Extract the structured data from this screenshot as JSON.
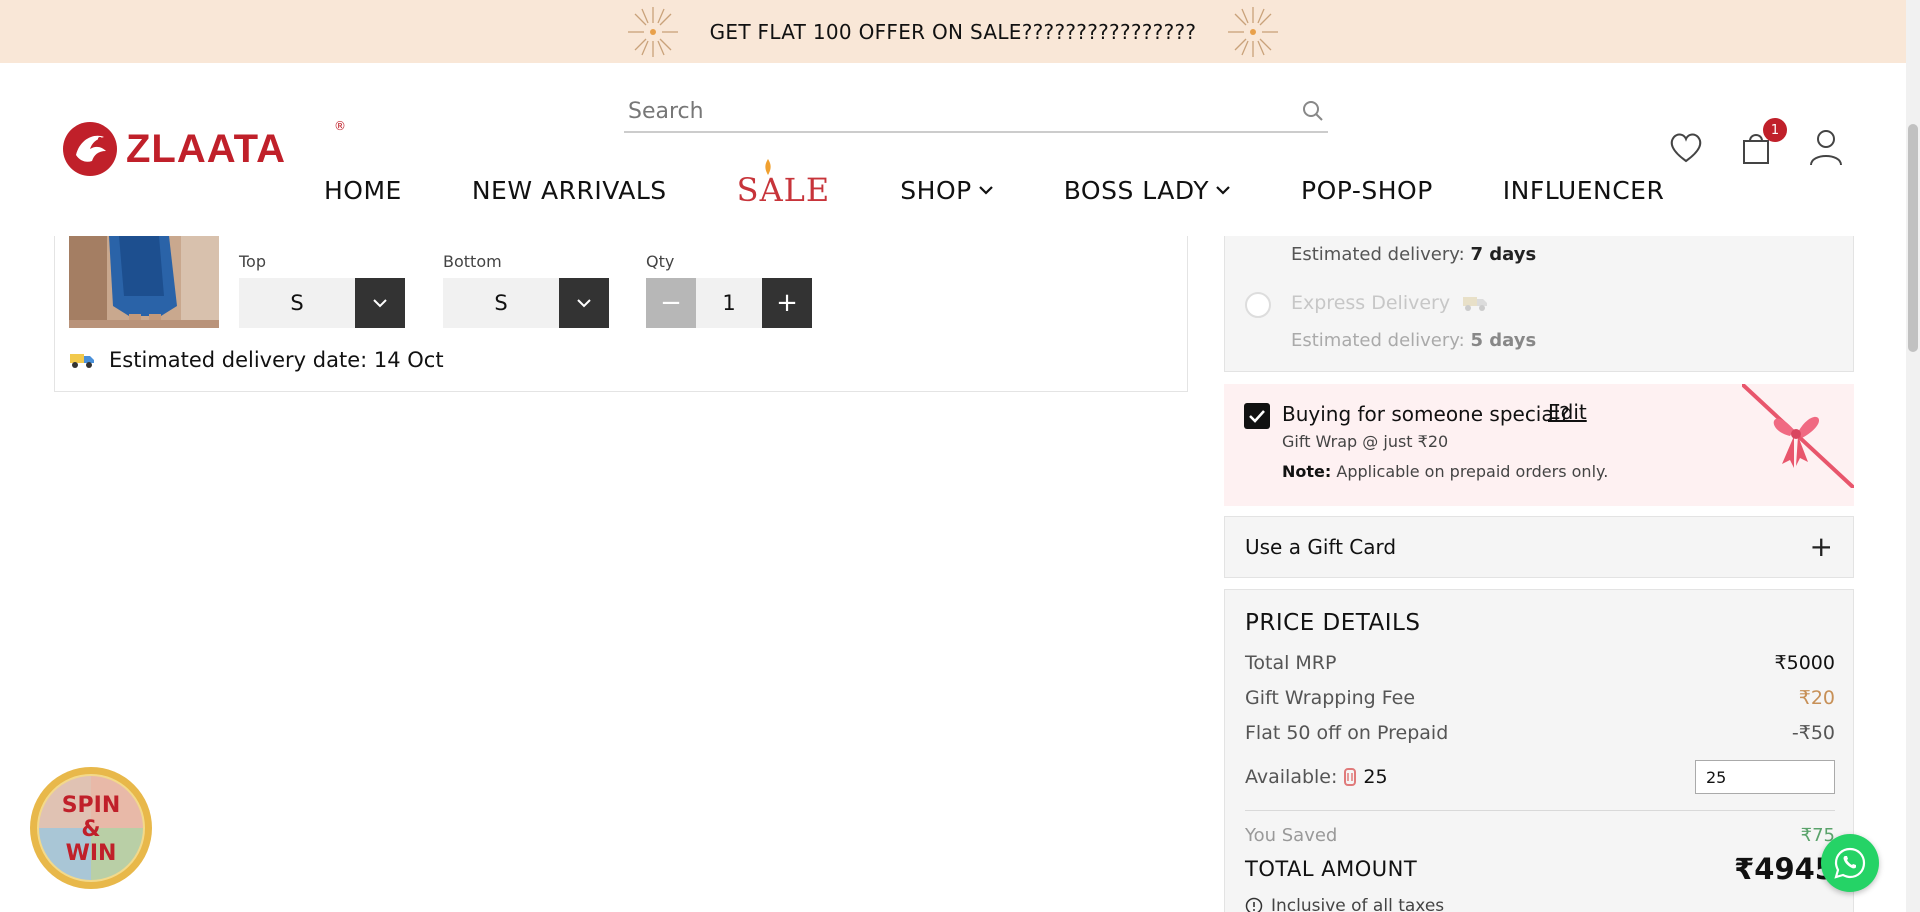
{
  "announcement": {
    "text": "GET FLAT 100 OFFER ON SALE????????????????"
  },
  "header": {
    "logo_text": "ZLAATA",
    "logo_reg": "®",
    "search_placeholder": "Search",
    "nav": [
      {
        "label": "HOME"
      },
      {
        "label": "NEW ARRIVALS"
      },
      {
        "label": "SALE"
      },
      {
        "label": "SHOP"
      },
      {
        "label": "BOSS LADY"
      },
      {
        "label": "POP-SHOP"
      },
      {
        "label": "INFLUENCER"
      }
    ],
    "cart_count": "1"
  },
  "cart_item": {
    "options": {
      "top_label": "Top",
      "top_value": "S",
      "bottom_label": "Bottom",
      "bottom_value": "S",
      "qty_label": "Qty",
      "qty_value": "1",
      "minus": "−",
      "plus": "+"
    },
    "estimated_delivery": "Estimated delivery date: 14 Oct"
  },
  "delivery": {
    "standard_est_label": "Estimated delivery:",
    "standard_est_value": "7 days",
    "express_label": "Express Delivery",
    "express_est_label": "Estimated delivery:",
    "express_est_value": "5 days"
  },
  "gift_wrap": {
    "title": "Buying for someone special?",
    "edit": "Edit",
    "sub": "Gift Wrap @ just ₹20",
    "note_label": "Note:",
    "note_text": "Applicable on prepaid orders only.",
    "checked": true
  },
  "gift_card": {
    "label": "Use a Gift Card",
    "plus": "+"
  },
  "price_details": {
    "title": "PRICE DETAILS",
    "rows": [
      {
        "label": "Total MRP",
        "value": "₹5000"
      },
      {
        "label": "Gift Wrapping Fee",
        "value": "₹20"
      },
      {
        "label": "Flat 50 off on Prepaid",
        "value": "-₹50"
      }
    ],
    "available_label": "Available:",
    "available_value": "25",
    "coin_input_value": "25",
    "saved_label": "You Saved",
    "saved_value": "₹75",
    "total_label": "TOTAL AMOUNT",
    "total_value": "₹4945",
    "tax_note": "Inclusive of all taxes"
  },
  "spin_win": {
    "line1": "SPIN",
    "line2": "&",
    "line3": "WIN"
  },
  "colors": {
    "brand": "#c0202a",
    "announce_bg": "#f9e7d7",
    "gift_bg": "#fef1f2",
    "panel_bg": "#f5f5f5"
  }
}
